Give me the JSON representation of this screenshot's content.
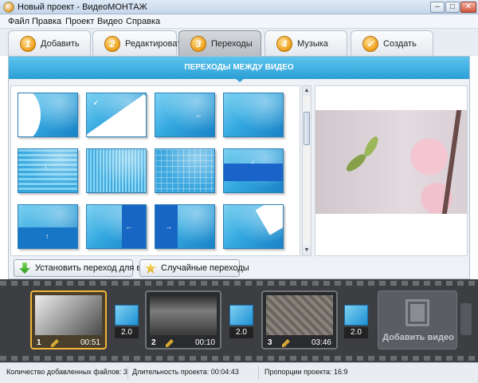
{
  "window": {
    "title": "Новый проект - ВидеоМОНТАЖ"
  },
  "menu": [
    "Файл",
    "Правка",
    "Проект",
    "Видео",
    "Справка"
  ],
  "steps": [
    {
      "num": "1",
      "label": "Добавить"
    },
    {
      "num": "2",
      "label": "Редактировать"
    },
    {
      "num": "3",
      "label": "Переходы",
      "active": true
    },
    {
      "num": "4",
      "label": "Музыка"
    },
    {
      "num": "✓",
      "label": "Создать"
    }
  ],
  "panel": {
    "title": "ПЕРЕХОДЫ МЕЖДУ ВИДЕО",
    "transitions_count": 12
  },
  "buttons": {
    "apply_all": "Установить переход для всех",
    "random": "Случайные переходы"
  },
  "timeline": {
    "clips": [
      {
        "index": "1",
        "duration": "00:51",
        "selected": true
      },
      {
        "index": "2",
        "duration": "00:10"
      },
      {
        "index": "3",
        "duration": "03:46"
      }
    ],
    "transitions": [
      "2.0",
      "2.0",
      "2.0"
    ],
    "add_video_label": "Добавить видео"
  },
  "status": {
    "files": "Количество добавленных файлов: 3",
    "duration": "Длительность проекта:  00:04:43",
    "aspect": "Пропорции проекта:  16:9"
  },
  "colors": {
    "accent": "#2c9fd6",
    "step_badge": "#f0a21e",
    "selected_clip": "#f2b43a"
  }
}
